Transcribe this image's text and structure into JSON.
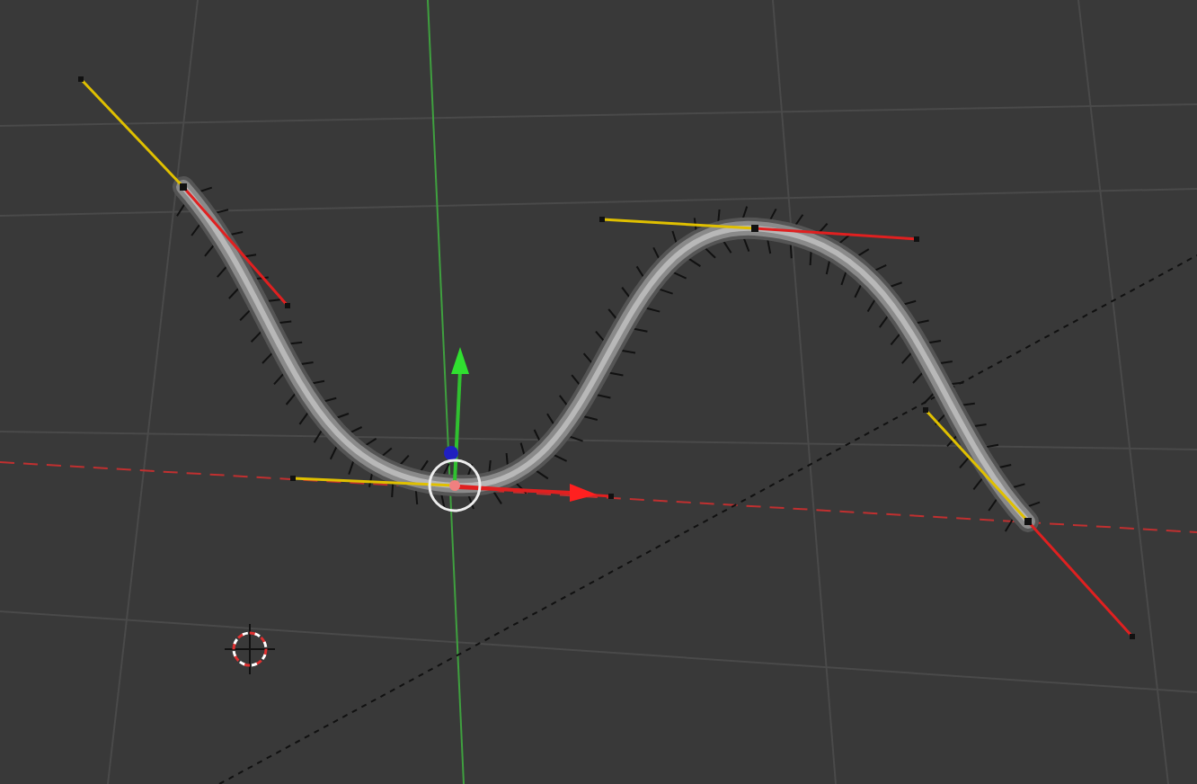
{
  "viewport": {
    "kind": "perspective"
  }
}
